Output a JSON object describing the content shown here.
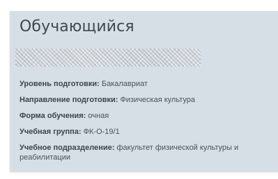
{
  "card": {
    "title": "Обучающийся"
  },
  "fields": [
    {
      "label": "Уровень подготовки:",
      "value": "Бакалавриат"
    },
    {
      "label": "Направление подготовки:",
      "value": "Физическая культура"
    },
    {
      "label": "Форма обучения:",
      "value": "очная"
    },
    {
      "label": "Учебная группа:",
      "value": "ФК-О-19/1"
    },
    {
      "label": "Учебное подразделение:",
      "value": "факультет физической культуры и реабилитации"
    }
  ]
}
